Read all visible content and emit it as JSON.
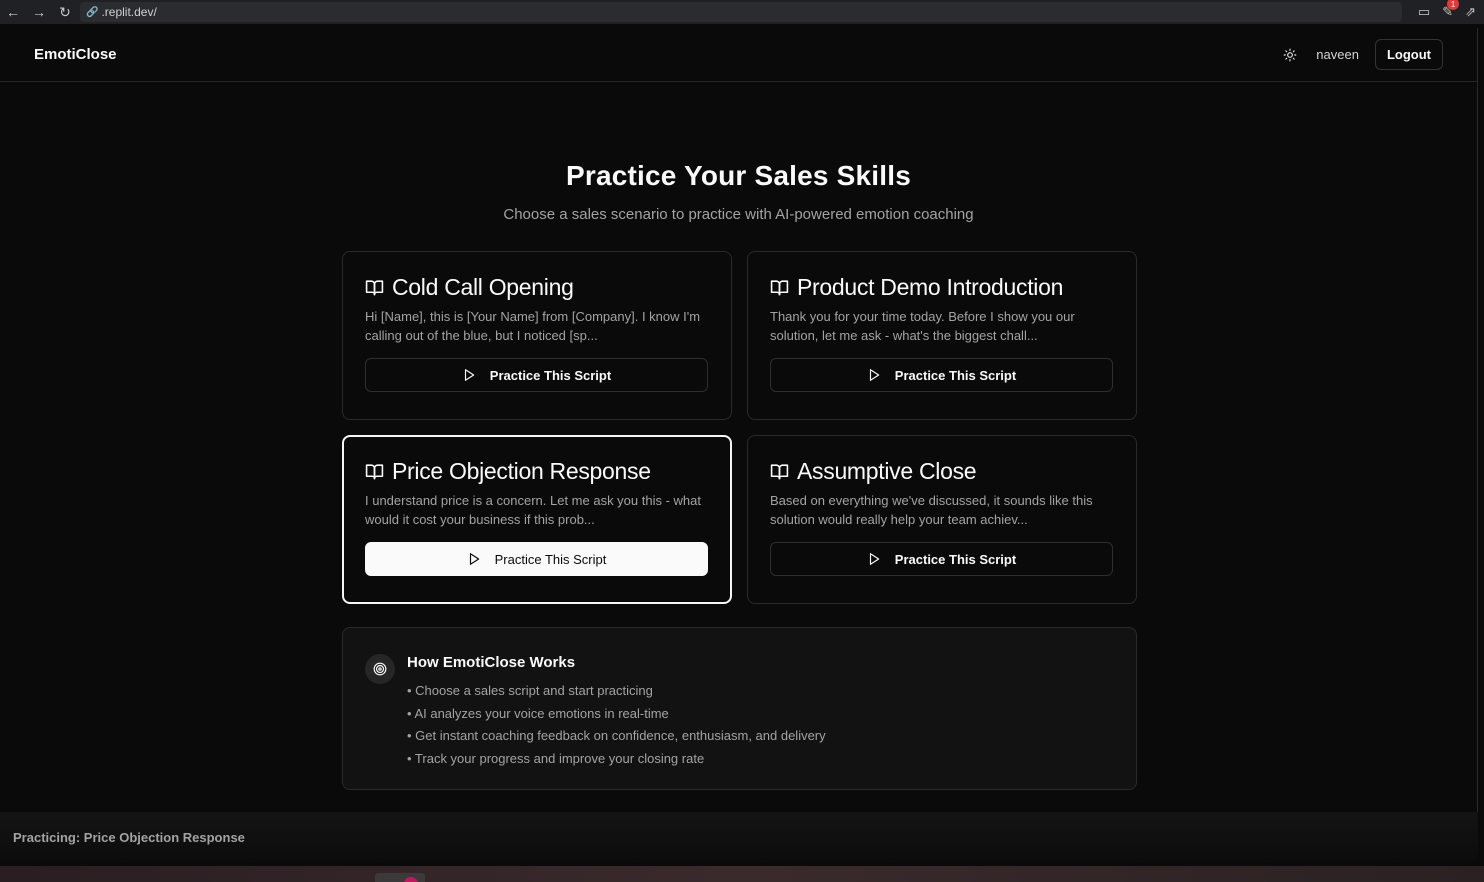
{
  "browser": {
    "url": ".replit.dev/",
    "extension_badge": "1"
  },
  "nav": {
    "brand": "EmotiClose",
    "username": "naveen",
    "logout_label": "Logout"
  },
  "hero": {
    "title": "Practice Your Sales Skills",
    "subtitle": "Choose a sales scenario to practice with AI-powered emotion coaching"
  },
  "scripts": [
    {
      "title": "Cold Call Opening",
      "description": "Hi [Name], this is [Your Name] from [Company]. I know I'm calling out of the blue, but I noticed [sp...",
      "button_label": "Practice This Script",
      "selected": false
    },
    {
      "title": "Product Demo Introduction",
      "description": "Thank you for your time today. Before I show you our solution, let me ask - what's the biggest chall...",
      "button_label": "Practice This Script",
      "selected": false
    },
    {
      "title": "Price Objection Response",
      "description": "I understand price is a concern. Let me ask you this - what would it cost your business if this prob...",
      "button_label": "Practice This Script",
      "selected": true
    },
    {
      "title": "Assumptive Close",
      "description": "Based on everything we've discussed, it sounds like this solution would really help your team achiev...",
      "button_label": "Practice This Script",
      "selected": false
    }
  ],
  "how_it_works": {
    "title": "How EmotiClose Works",
    "steps": [
      "• Choose a sales script and start practicing",
      "• AI analyzes your voice emotions in real-time",
      "• Get instant coaching feedback on confidence, enthusiasm, and delivery",
      "• Track your progress and improve your closing rate"
    ]
  },
  "status": {
    "text": "Practicing: Price Objection Response"
  },
  "colors": {
    "background": "#0a0a0a",
    "card_border": "#2a2a2a",
    "selected_border": "#f5f5f5",
    "muted_text": "#a3a3a3"
  }
}
